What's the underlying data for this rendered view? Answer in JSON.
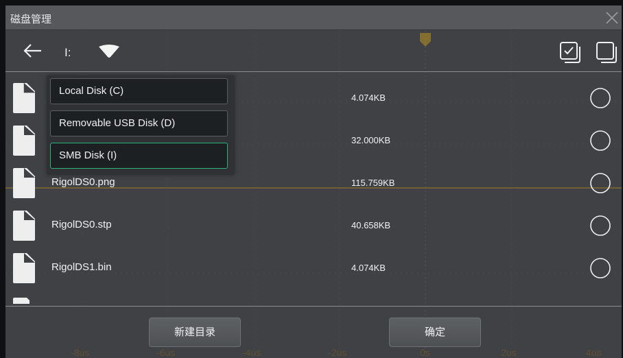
{
  "dialog": {
    "title": "磁盘管理"
  },
  "toolbar": {
    "current_drive": "I:"
  },
  "drive_menu": {
    "options": [
      {
        "label": "Local Disk (C)"
      },
      {
        "label": "Removable USB Disk (D)"
      },
      {
        "label": "SMB Disk (I)"
      }
    ],
    "selected": "SMB Disk (I)"
  },
  "files": [
    {
      "name": "",
      "size": "4.074KB"
    },
    {
      "name": "",
      "size": "32.000KB"
    },
    {
      "name": "RigolDS0.png",
      "size": "115.759KB"
    },
    {
      "name": "RigolDS0.stp",
      "size": "40.658KB"
    },
    {
      "name": "RigolDS1.bin",
      "size": "4.074KB"
    }
  ],
  "buttons": {
    "new_folder": "新建目录",
    "confirm": "确定"
  },
  "background_axis": {
    "labels": [
      "-8us",
      "-6us",
      "-4us",
      "-2us",
      "0s",
      "2us",
      "4us"
    ]
  },
  "colors": {
    "dialog_bg": "#3f4144",
    "title_bar": "#56585c",
    "selected_border": "#2db37a",
    "trace": "#c99a1e"
  },
  "icons": {
    "back": "arrow-left-icon",
    "drive_toggle": "triangle-down-icon",
    "select_all": "checkbox-checked-icon",
    "deselect_all": "checkbox-empty-icon",
    "file": "file-icon",
    "radio": "radio-unchecked-icon",
    "close": "close-icon"
  }
}
